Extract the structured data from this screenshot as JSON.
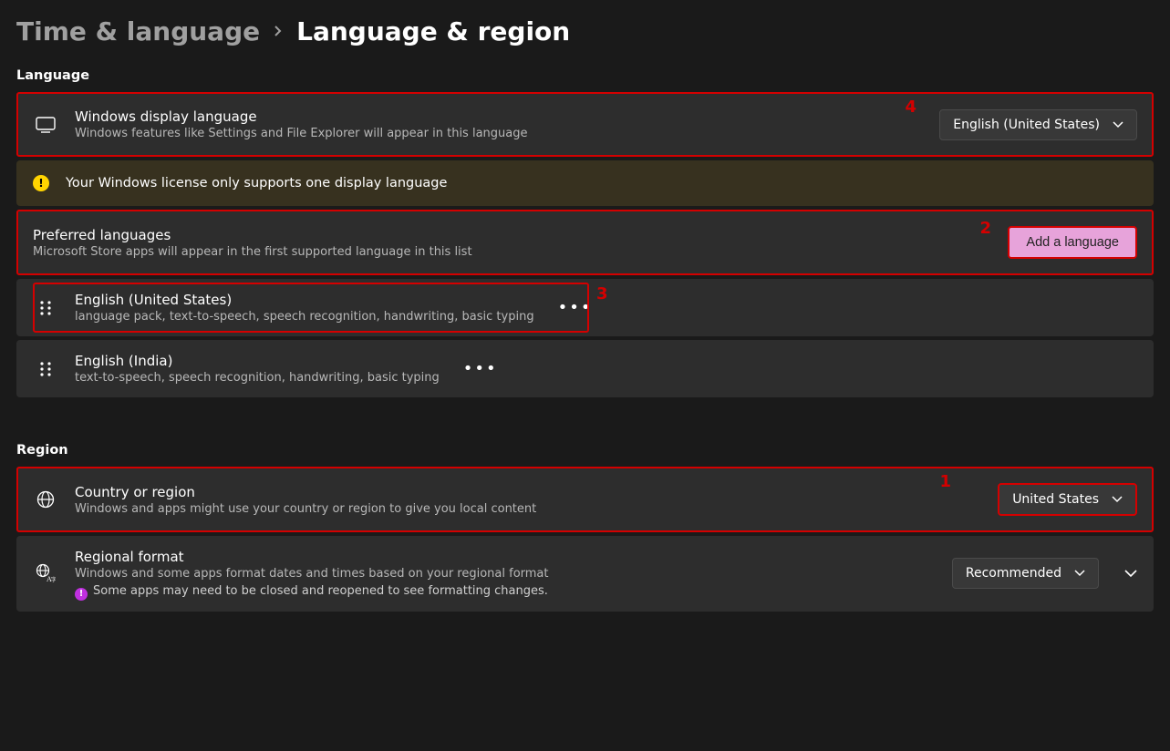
{
  "breadcrumb": {
    "parent": "Time & language",
    "current": "Language & region"
  },
  "sections": {
    "language_label": "Language",
    "region_label": "Region"
  },
  "display_language": {
    "title": "Windows display language",
    "subtitle": "Windows features like Settings and File Explorer will appear in this language",
    "value": "English (United States)"
  },
  "license_warning": "Your Windows license only supports one display language",
  "preferred": {
    "title": "Preferred languages",
    "subtitle": "Microsoft Store apps will appear in the first supported language in this list",
    "add_label": "Add a language"
  },
  "languages": [
    {
      "name": "English (United States)",
      "features": "language pack, text-to-speech, speech recognition, handwriting, basic typing"
    },
    {
      "name": "English (India)",
      "features": "text-to-speech, speech recognition, handwriting, basic typing"
    }
  ],
  "country": {
    "title": "Country or region",
    "subtitle": "Windows and apps might use your country or region to give you local content",
    "value": "United States"
  },
  "regional_format": {
    "title": "Regional format",
    "subtitle": "Windows and some apps format dates and times based on your regional format",
    "note": "Some apps may need to be closed and reopened to see formatting changes.",
    "value": "Recommended"
  },
  "annotations": {
    "a1": "1",
    "a2": "2",
    "a3": "3",
    "a4": "4"
  }
}
